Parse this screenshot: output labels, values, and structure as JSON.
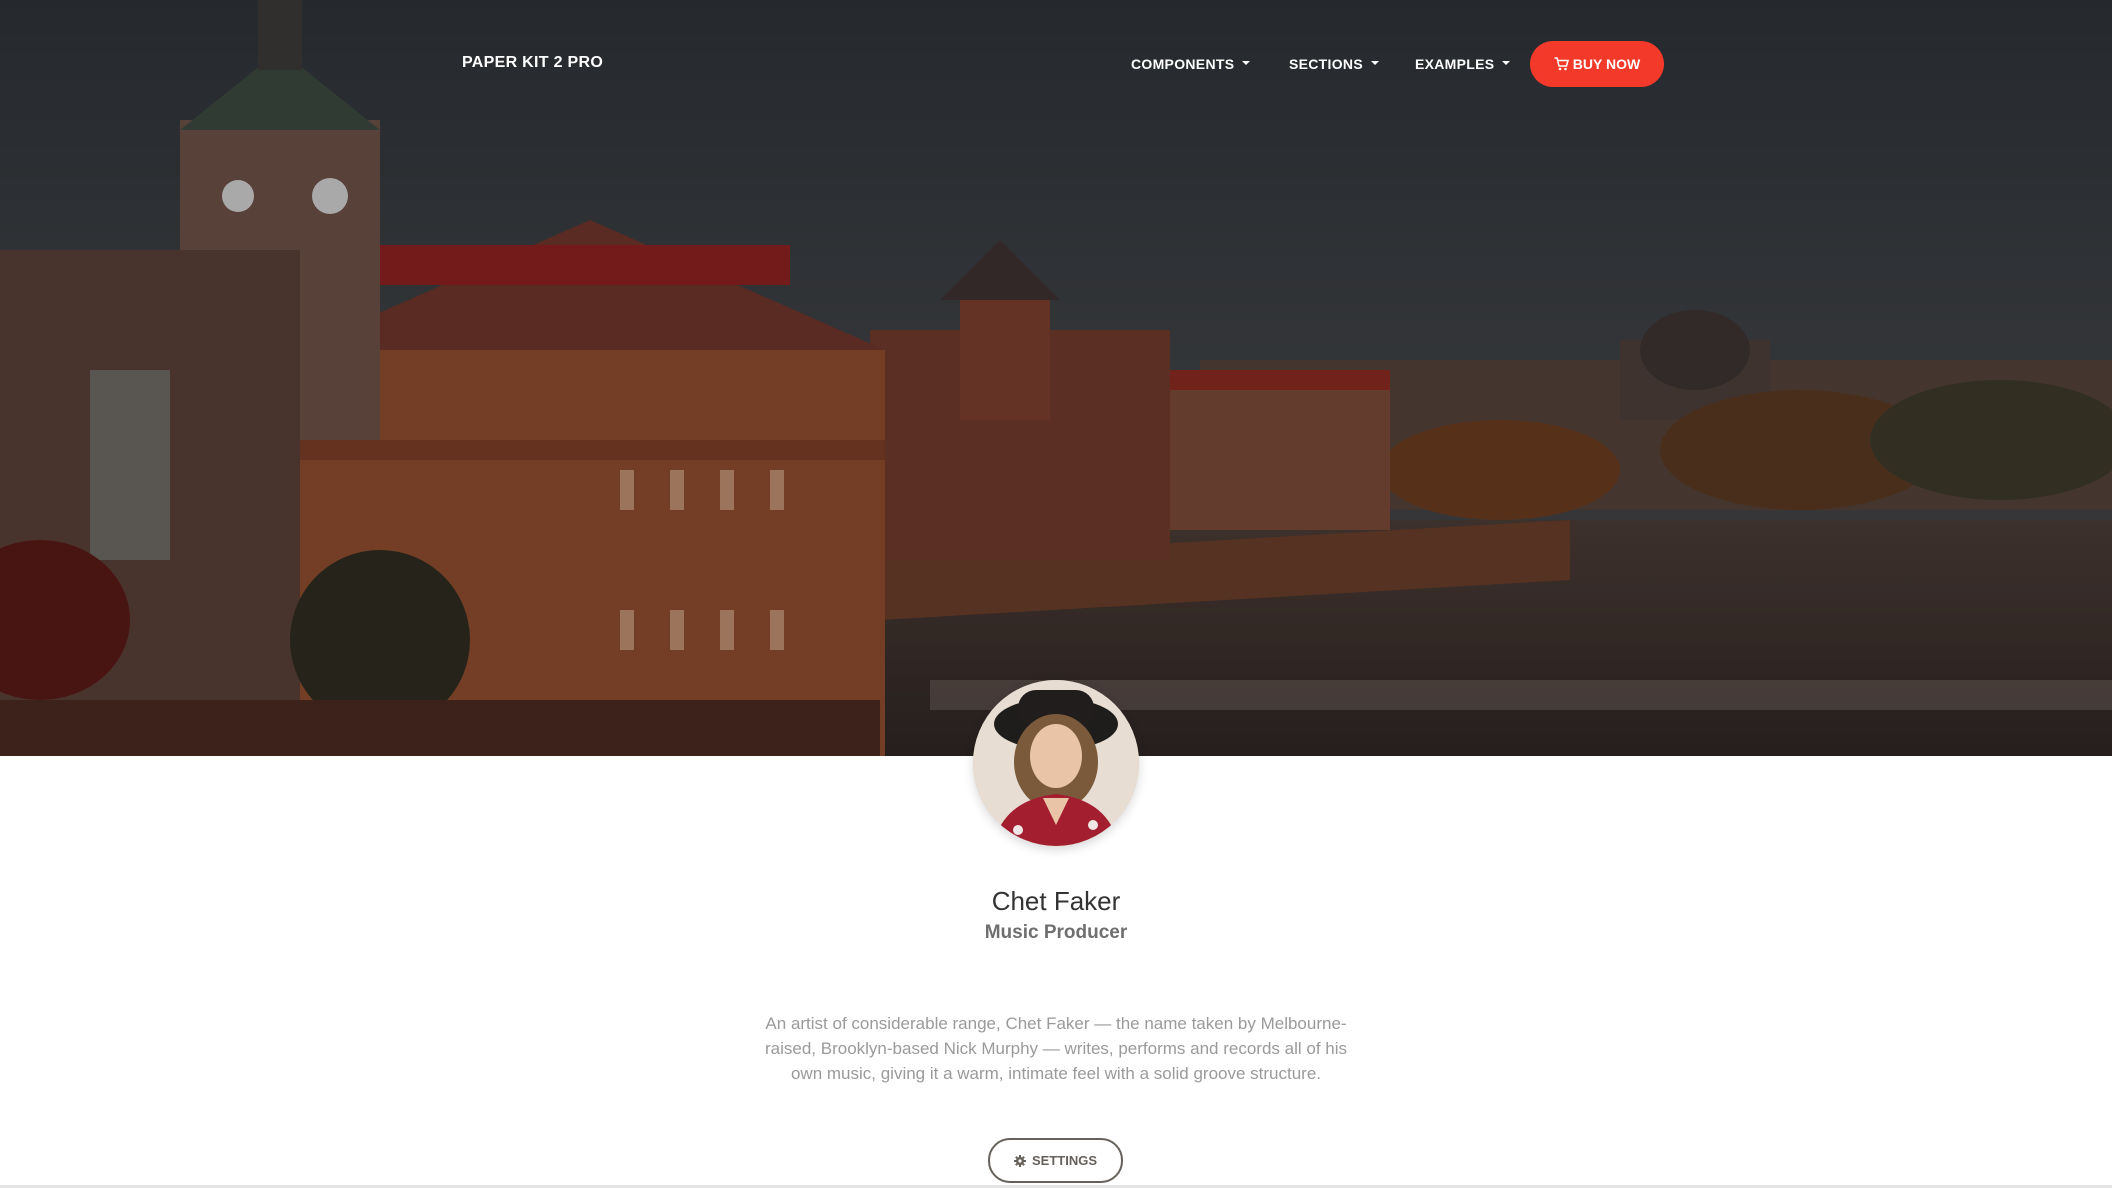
{
  "navbar": {
    "brand": "PAPER KIT 2 PRO",
    "items": [
      {
        "label": "COMPONENTS"
      },
      {
        "label": "SECTIONS"
      },
      {
        "label": "EXAMPLES"
      }
    ],
    "buy_label": "BUY NOW"
  },
  "profile": {
    "name": "Chet Faker",
    "title": "Music Producer",
    "bio": "An artist of considerable range, Chet Faker — the name taken by Melbourne-raised, Brooklyn-based Nick Murphy — writes, performs and records all of his own music, giving it a warm, intimate feel with a solid groove structure.",
    "settings_label": "SETTINGS"
  },
  "colors": {
    "accent": "#f33a2a",
    "button_outline": "#66615b"
  },
  "icons": {
    "cart": "shopping-cart-icon",
    "settings": "gear-icon"
  }
}
